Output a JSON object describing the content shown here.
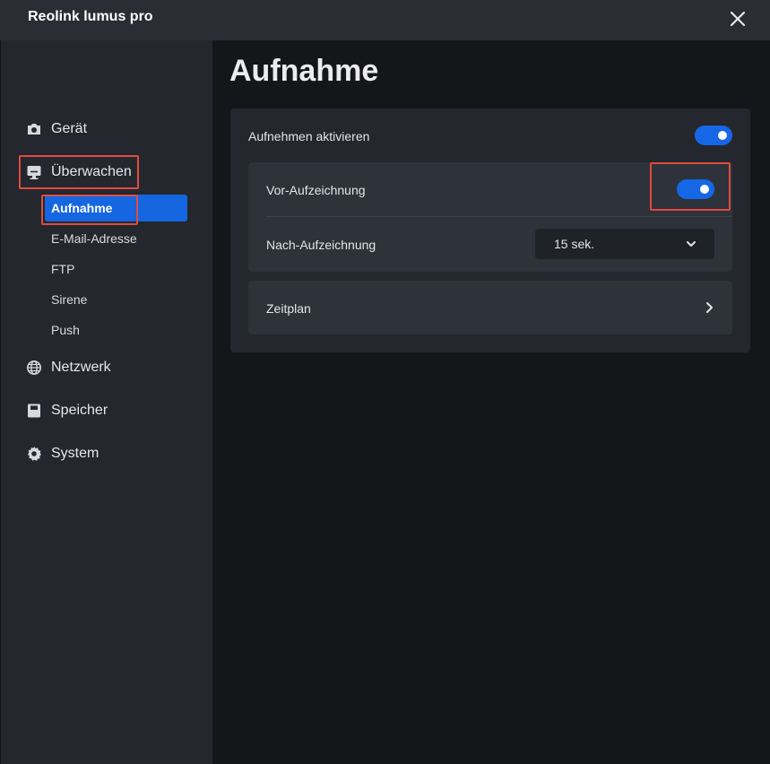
{
  "window": {
    "title": "Reolink lumus pro"
  },
  "sidebar": {
    "items": [
      {
        "label": "Gerät",
        "icon": "camera-icon"
      },
      {
        "label": "Überwachen",
        "icon": "monitor-icon"
      },
      {
        "label": "Netzwerk",
        "icon": "globe-icon"
      },
      {
        "label": "Speicher",
        "icon": "sd-card-icon"
      },
      {
        "label": "System",
        "icon": "gear-icon"
      }
    ],
    "subitems": [
      {
        "label": "Aufnahme",
        "active": true
      },
      {
        "label": "E-Mail-Adresse"
      },
      {
        "label": "FTP"
      },
      {
        "label": "Sirene"
      },
      {
        "label": "Push"
      }
    ]
  },
  "main": {
    "title": "Aufnahme",
    "enable_recording": {
      "label": "Aufnehmen aktivieren",
      "on": true
    },
    "pre_recording": {
      "label": "Vor-Aufzeichnung",
      "on": true
    },
    "post_recording": {
      "label": "Nach-Aufzeichnung",
      "value": "15 sek."
    },
    "schedule": {
      "label": "Zeitplan"
    }
  },
  "colors": {
    "accent": "#1567e6",
    "highlight_box": "#e04b3f"
  }
}
